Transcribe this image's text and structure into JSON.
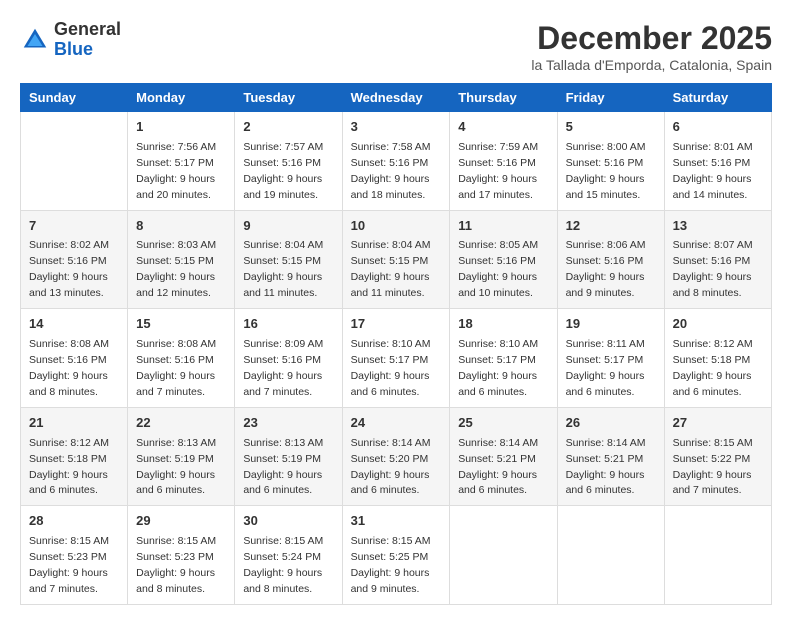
{
  "logo": {
    "general": "General",
    "blue": "Blue"
  },
  "header": {
    "month": "December 2025",
    "location": "la Tallada d'Emporda, Catalonia, Spain"
  },
  "weekdays": [
    "Sunday",
    "Monday",
    "Tuesday",
    "Wednesday",
    "Thursday",
    "Friday",
    "Saturday"
  ],
  "weeks": [
    [
      {
        "day": "",
        "sunrise": "",
        "sunset": "",
        "daylight": "",
        "empty": true
      },
      {
        "day": "1",
        "sunrise": "Sunrise: 7:56 AM",
        "sunset": "Sunset: 5:17 PM",
        "daylight": "Daylight: 9 hours and 20 minutes.",
        "empty": false
      },
      {
        "day": "2",
        "sunrise": "Sunrise: 7:57 AM",
        "sunset": "Sunset: 5:16 PM",
        "daylight": "Daylight: 9 hours and 19 minutes.",
        "empty": false
      },
      {
        "day": "3",
        "sunrise": "Sunrise: 7:58 AM",
        "sunset": "Sunset: 5:16 PM",
        "daylight": "Daylight: 9 hours and 18 minutes.",
        "empty": false
      },
      {
        "day": "4",
        "sunrise": "Sunrise: 7:59 AM",
        "sunset": "Sunset: 5:16 PM",
        "daylight": "Daylight: 9 hours and 17 minutes.",
        "empty": false
      },
      {
        "day": "5",
        "sunrise": "Sunrise: 8:00 AM",
        "sunset": "Sunset: 5:16 PM",
        "daylight": "Daylight: 9 hours and 15 minutes.",
        "empty": false
      },
      {
        "day": "6",
        "sunrise": "Sunrise: 8:01 AM",
        "sunset": "Sunset: 5:16 PM",
        "daylight": "Daylight: 9 hours and 14 minutes.",
        "empty": false
      }
    ],
    [
      {
        "day": "7",
        "sunrise": "Sunrise: 8:02 AM",
        "sunset": "Sunset: 5:16 PM",
        "daylight": "Daylight: 9 hours and 13 minutes.",
        "empty": false
      },
      {
        "day": "8",
        "sunrise": "Sunrise: 8:03 AM",
        "sunset": "Sunset: 5:15 PM",
        "daylight": "Daylight: 9 hours and 12 minutes.",
        "empty": false
      },
      {
        "day": "9",
        "sunrise": "Sunrise: 8:04 AM",
        "sunset": "Sunset: 5:15 PM",
        "daylight": "Daylight: 9 hours and 11 minutes.",
        "empty": false
      },
      {
        "day": "10",
        "sunrise": "Sunrise: 8:04 AM",
        "sunset": "Sunset: 5:15 PM",
        "daylight": "Daylight: 9 hours and 11 minutes.",
        "empty": false
      },
      {
        "day": "11",
        "sunrise": "Sunrise: 8:05 AM",
        "sunset": "Sunset: 5:16 PM",
        "daylight": "Daylight: 9 hours and 10 minutes.",
        "empty": false
      },
      {
        "day": "12",
        "sunrise": "Sunrise: 8:06 AM",
        "sunset": "Sunset: 5:16 PM",
        "daylight": "Daylight: 9 hours and 9 minutes.",
        "empty": false
      },
      {
        "day": "13",
        "sunrise": "Sunrise: 8:07 AM",
        "sunset": "Sunset: 5:16 PM",
        "daylight": "Daylight: 9 hours and 8 minutes.",
        "empty": false
      }
    ],
    [
      {
        "day": "14",
        "sunrise": "Sunrise: 8:08 AM",
        "sunset": "Sunset: 5:16 PM",
        "daylight": "Daylight: 9 hours and 8 minutes.",
        "empty": false
      },
      {
        "day": "15",
        "sunrise": "Sunrise: 8:08 AM",
        "sunset": "Sunset: 5:16 PM",
        "daylight": "Daylight: 9 hours and 7 minutes.",
        "empty": false
      },
      {
        "day": "16",
        "sunrise": "Sunrise: 8:09 AM",
        "sunset": "Sunset: 5:16 PM",
        "daylight": "Daylight: 9 hours and 7 minutes.",
        "empty": false
      },
      {
        "day": "17",
        "sunrise": "Sunrise: 8:10 AM",
        "sunset": "Sunset: 5:17 PM",
        "daylight": "Daylight: 9 hours and 6 minutes.",
        "empty": false
      },
      {
        "day": "18",
        "sunrise": "Sunrise: 8:10 AM",
        "sunset": "Sunset: 5:17 PM",
        "daylight": "Daylight: 9 hours and 6 minutes.",
        "empty": false
      },
      {
        "day": "19",
        "sunrise": "Sunrise: 8:11 AM",
        "sunset": "Sunset: 5:17 PM",
        "daylight": "Daylight: 9 hours and 6 minutes.",
        "empty": false
      },
      {
        "day": "20",
        "sunrise": "Sunrise: 8:12 AM",
        "sunset": "Sunset: 5:18 PM",
        "daylight": "Daylight: 9 hours and 6 minutes.",
        "empty": false
      }
    ],
    [
      {
        "day": "21",
        "sunrise": "Sunrise: 8:12 AM",
        "sunset": "Sunset: 5:18 PM",
        "daylight": "Daylight: 9 hours and 6 minutes.",
        "empty": false
      },
      {
        "day": "22",
        "sunrise": "Sunrise: 8:13 AM",
        "sunset": "Sunset: 5:19 PM",
        "daylight": "Daylight: 9 hours and 6 minutes.",
        "empty": false
      },
      {
        "day": "23",
        "sunrise": "Sunrise: 8:13 AM",
        "sunset": "Sunset: 5:19 PM",
        "daylight": "Daylight: 9 hours and 6 minutes.",
        "empty": false
      },
      {
        "day": "24",
        "sunrise": "Sunrise: 8:14 AM",
        "sunset": "Sunset: 5:20 PM",
        "daylight": "Daylight: 9 hours and 6 minutes.",
        "empty": false
      },
      {
        "day": "25",
        "sunrise": "Sunrise: 8:14 AM",
        "sunset": "Sunset: 5:21 PM",
        "daylight": "Daylight: 9 hours and 6 minutes.",
        "empty": false
      },
      {
        "day": "26",
        "sunrise": "Sunrise: 8:14 AM",
        "sunset": "Sunset: 5:21 PM",
        "daylight": "Daylight: 9 hours and 6 minutes.",
        "empty": false
      },
      {
        "day": "27",
        "sunrise": "Sunrise: 8:15 AM",
        "sunset": "Sunset: 5:22 PM",
        "daylight": "Daylight: 9 hours and 7 minutes.",
        "empty": false
      }
    ],
    [
      {
        "day": "28",
        "sunrise": "Sunrise: 8:15 AM",
        "sunset": "Sunset: 5:23 PM",
        "daylight": "Daylight: 9 hours and 7 minutes.",
        "empty": false
      },
      {
        "day": "29",
        "sunrise": "Sunrise: 8:15 AM",
        "sunset": "Sunset: 5:23 PM",
        "daylight": "Daylight: 9 hours and 8 minutes.",
        "empty": false
      },
      {
        "day": "30",
        "sunrise": "Sunrise: 8:15 AM",
        "sunset": "Sunset: 5:24 PM",
        "daylight": "Daylight: 9 hours and 8 minutes.",
        "empty": false
      },
      {
        "day": "31",
        "sunrise": "Sunrise: 8:15 AM",
        "sunset": "Sunset: 5:25 PM",
        "daylight": "Daylight: 9 hours and 9 minutes.",
        "empty": false
      },
      {
        "day": "",
        "sunrise": "",
        "sunset": "",
        "daylight": "",
        "empty": true
      },
      {
        "day": "",
        "sunrise": "",
        "sunset": "",
        "daylight": "",
        "empty": true
      },
      {
        "day": "",
        "sunrise": "",
        "sunset": "",
        "daylight": "",
        "empty": true
      }
    ]
  ]
}
